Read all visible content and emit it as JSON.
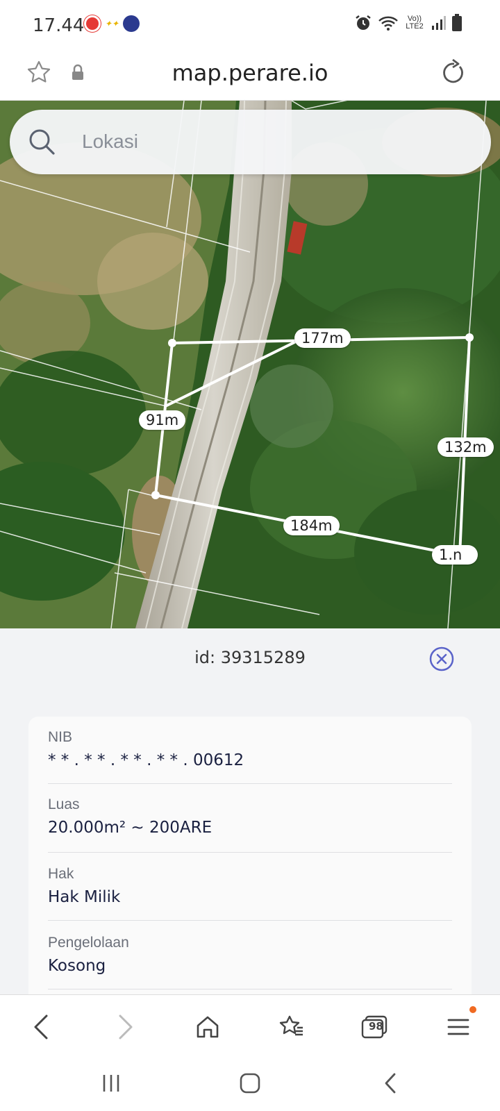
{
  "status_bar": {
    "time": "17.44",
    "network": "Vo)) LTE2"
  },
  "browser": {
    "url": "map.perare.io"
  },
  "search": {
    "placeholder": "Lokasi"
  },
  "map": {
    "segment_labels": [
      "177m",
      "91m",
      "132m",
      "184m",
      "1.n"
    ]
  },
  "panel": {
    "title": "id: 39315289",
    "fields": [
      {
        "label": "NIB",
        "value": "* * . * * . * * . * * . 00612"
      },
      {
        "label": "Luas",
        "value": "20.000m² ~ 200ARE"
      },
      {
        "label": "Hak",
        "value": "Hak Milik"
      },
      {
        "label": "Pengelolaan",
        "value": "Kosong"
      }
    ]
  },
  "bottom_nav": {
    "tabs_count": "98",
    "icons": [
      "back-icon",
      "forward-icon",
      "home-icon",
      "bookmarks-icon",
      "tabs-icon",
      "menu-icon"
    ]
  },
  "colors": {
    "accent": "#5a63c9",
    "badge": "#f06a22"
  }
}
